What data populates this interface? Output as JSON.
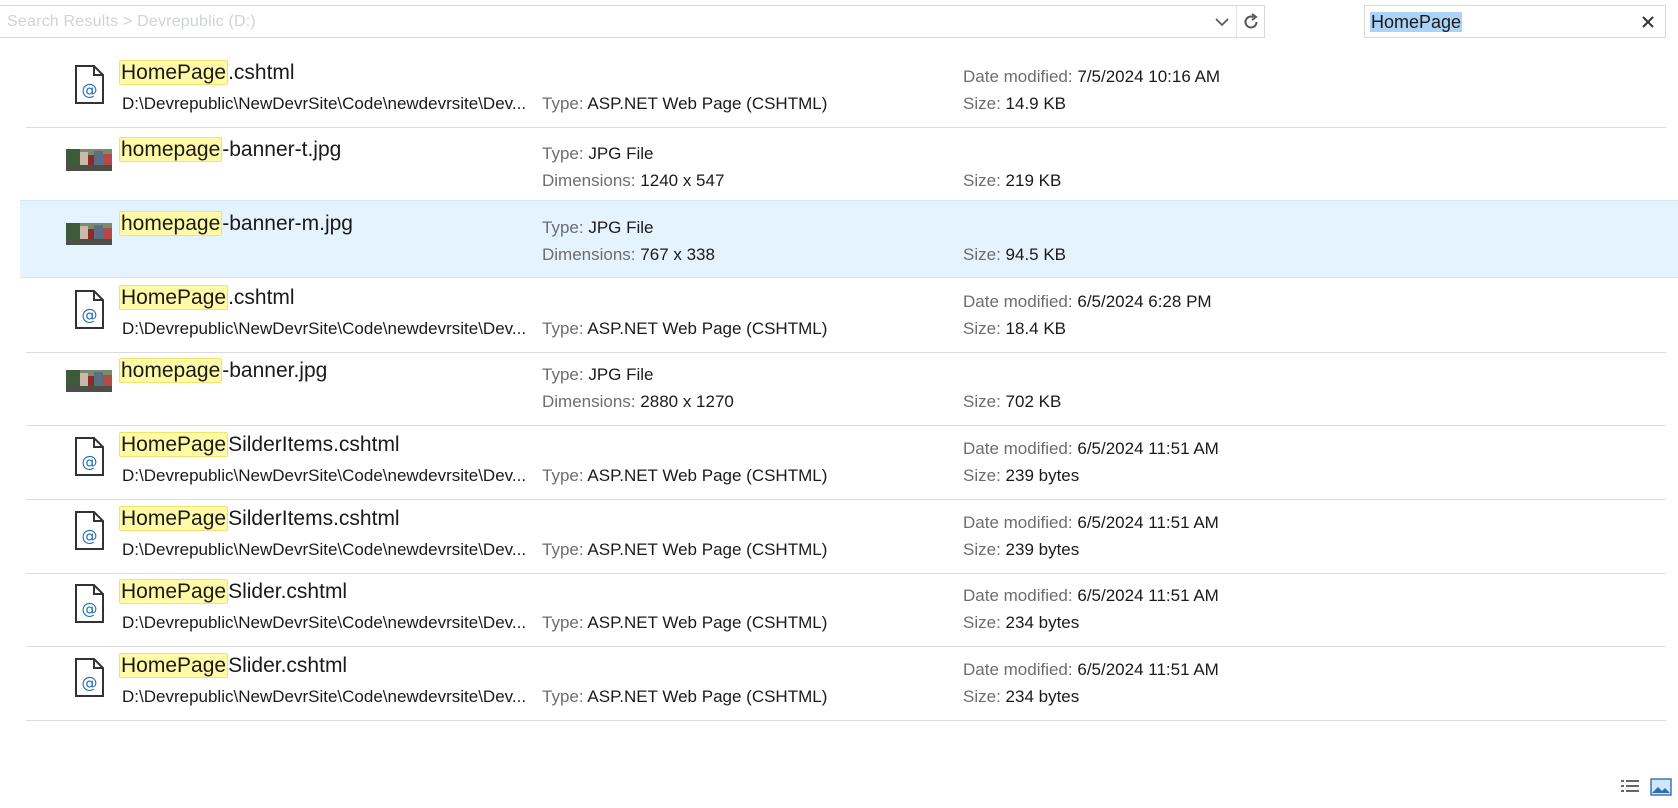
{
  "address_bar": {
    "text": "Search Results > Devrepublic (D:)",
    "dropdown_icon": "chevron-down-icon",
    "refresh_icon": "refresh-icon"
  },
  "search": {
    "value": "HomePage",
    "clear_icon": "close-icon"
  },
  "labels": {
    "date_modified": "Date modified:",
    "size": "Size:",
    "type": "Type:",
    "dimensions": "Dimensions:"
  },
  "results": [
    {
      "kind": "cshtml",
      "match": "HomePage",
      "rest": ".cshtml",
      "path": "D:\\Devrepublic\\NewDevrSite\\Code\\newdevrsite\\Dev...",
      "type": "ASP.NET Web Page (CSHTML)",
      "date_modified": "7/5/2024 10:16 AM",
      "size": "14.9 KB"
    },
    {
      "kind": "jpg",
      "match": "homepage",
      "rest": "-banner-t.jpg",
      "type": "JPG File",
      "dimensions": "1240 x 547",
      "size": "219 KB"
    },
    {
      "kind": "jpg",
      "selected": true,
      "match": "homepage",
      "rest": "-banner-m.jpg",
      "type": "JPG File",
      "dimensions": "767 x 338",
      "size": "94.5 KB"
    },
    {
      "kind": "cshtml",
      "match": "HomePage",
      "rest": ".cshtml",
      "path": "D:\\Devrepublic\\NewDevrSite\\Code\\newdevrsite\\Dev...",
      "type": "ASP.NET Web Page (CSHTML)",
      "date_modified": "6/5/2024 6:28 PM",
      "size": "18.4 KB"
    },
    {
      "kind": "jpg",
      "match": "homepage",
      "rest": "-banner.jpg",
      "type": "JPG File",
      "dimensions": "2880 x 1270",
      "size": "702 KB"
    },
    {
      "kind": "cshtml",
      "match": "HomePage",
      "rest": "SilderItems.cshtml",
      "path": "D:\\Devrepublic\\NewDevrSite\\Code\\newdevrsite\\Dev...",
      "type": "ASP.NET Web Page (CSHTML)",
      "date_modified": "6/5/2024 11:51 AM",
      "size": "239 bytes"
    },
    {
      "kind": "cshtml",
      "match": "HomePage",
      "rest": "SilderItems.cshtml",
      "path": "D:\\Devrepublic\\NewDevrSite\\Code\\newdevrsite\\Dev...",
      "type": "ASP.NET Web Page (CSHTML)",
      "date_modified": "6/5/2024 11:51 AM",
      "size": "239 bytes"
    },
    {
      "kind": "cshtml",
      "match": "HomePage",
      "rest": "Slider.cshtml",
      "path": "D:\\Devrepublic\\NewDevrSite\\Code\\newdevrsite\\Dev...",
      "type": "ASP.NET Web Page (CSHTML)",
      "date_modified": "6/5/2024 11:51 AM",
      "size": "234 bytes"
    },
    {
      "kind": "cshtml",
      "match": "HomePage",
      "rest": "Slider.cshtml",
      "path": "D:\\Devrepublic\\NewDevrSite\\Code\\newdevrsite\\Dev...",
      "type": "ASP.NET Web Page (CSHTML)",
      "date_modified": "6/5/2024 11:51 AM",
      "size": "234 bytes"
    }
  ],
  "view_buttons": {
    "details_icon": "details-view-icon",
    "large_icon": "large-icons-view-icon"
  },
  "colors": {
    "highlight": "#fffaa6",
    "selected_row": "#e5f3ff",
    "search_selection": "#aad3f5",
    "label_gray": "#6d6d6d"
  }
}
